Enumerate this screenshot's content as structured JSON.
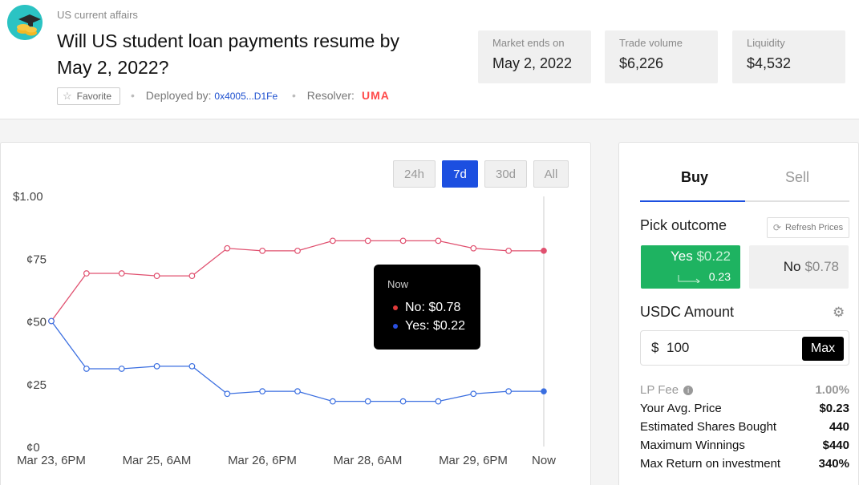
{
  "header": {
    "category": "US current affairs",
    "title": "Will US student loan payments resume by May 2, 2022?",
    "favorite_label": "Favorite",
    "deployed_label": "Deployed by:",
    "deployed_address": "0x4005...D1Fe",
    "resolver_label": "Resolver:",
    "resolver_name": "UMA"
  },
  "stats": [
    {
      "label": "Market ends on",
      "value": "May 2, 2022"
    },
    {
      "label": "Trade volume",
      "value": "$6,226"
    },
    {
      "label": "Liquidity",
      "value": "$4,532"
    }
  ],
  "chart": {
    "range_buttons": [
      "24h",
      "7d",
      "30d",
      "All"
    ],
    "active_range": "7d",
    "y_ticks": [
      "$1.00",
      "¢75",
      "¢50",
      "¢25",
      "¢0"
    ],
    "x_ticks": [
      "Mar 23, 6PM",
      "Mar 25, 6AM",
      "Mar 26, 6PM",
      "Mar 28, 6AM",
      "Mar 29, 6PM",
      "Now"
    ],
    "tooltip": {
      "title": "Now",
      "no_text": "No: $0.78",
      "yes_text": "Yes: $0.22"
    },
    "colors": {
      "no": "#e0506f",
      "yes": "#3a6ee0"
    }
  },
  "chart_data": {
    "type": "line",
    "ylim": [
      0,
      1
    ],
    "x": [
      "Mar 23, 6PM",
      "",
      "",
      "",
      "",
      "",
      "",
      "",
      "",
      "",
      "",
      "",
      "",
      "",
      "Now"
    ],
    "series": [
      {
        "name": "No",
        "values": [
          0.5,
          0.69,
          0.69,
          0.68,
          0.68,
          0.79,
          0.78,
          0.78,
          0.82,
          0.82,
          0.82,
          0.82,
          0.79,
          0.78,
          0.78
        ]
      },
      {
        "name": "Yes",
        "values": [
          0.5,
          0.31,
          0.31,
          0.32,
          0.32,
          0.21,
          0.22,
          0.22,
          0.18,
          0.18,
          0.18,
          0.18,
          0.21,
          0.22,
          0.22
        ]
      }
    ]
  },
  "trade": {
    "tab_buy": "Buy",
    "tab_sell": "Sell",
    "pick_outcome_label": "Pick outcome",
    "refresh_label": "Refresh Prices",
    "yes_label": "Yes",
    "yes_price": "$0.22",
    "yes_sub": "0.23",
    "no_label": "No",
    "no_price": "$0.78",
    "amount_label": "USDC Amount",
    "currency_symbol": "$",
    "amount_value": "100",
    "max_label": "Max",
    "details": [
      {
        "label": "LP Fee",
        "value": "1.00%"
      },
      {
        "label": "Your Avg. Price",
        "value": "$0.23"
      },
      {
        "label": "Estimated Shares Bought",
        "value": "440"
      },
      {
        "label": "Maximum Winnings",
        "value": "$440"
      },
      {
        "label": "Max Return on investment",
        "value": "340%"
      }
    ]
  }
}
